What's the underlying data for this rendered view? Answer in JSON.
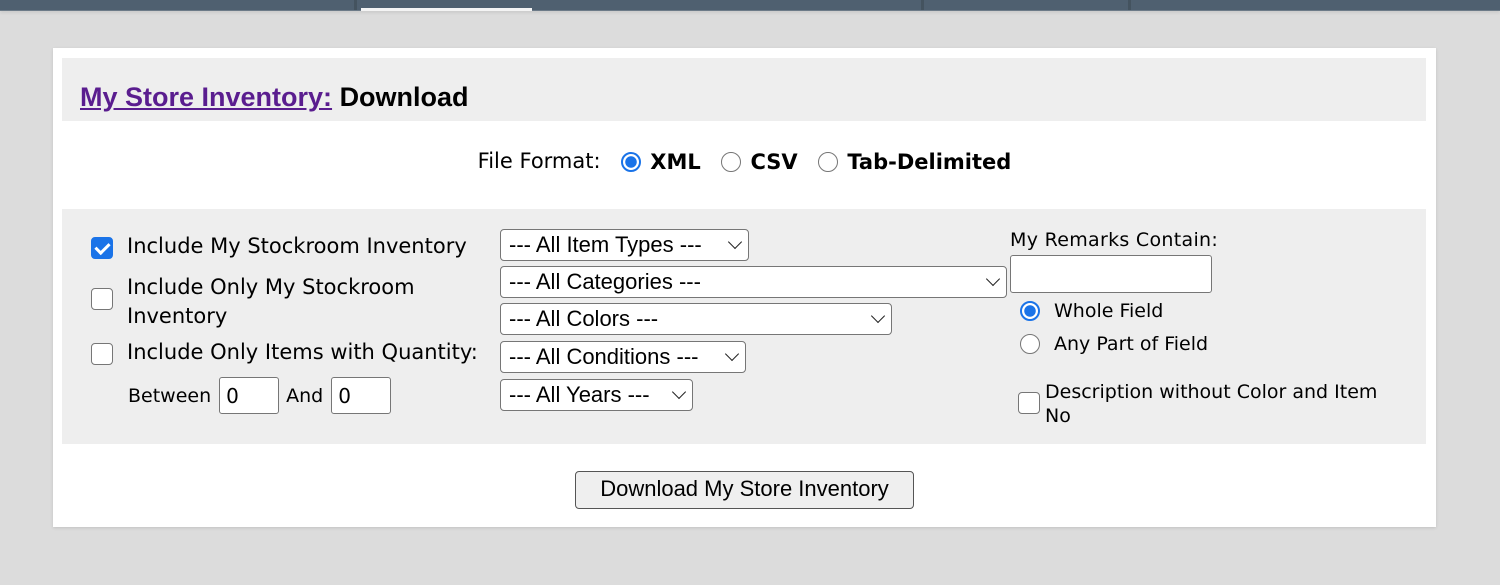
{
  "topnav": {
    "active_tab_index": 1
  },
  "header": {
    "link_text": "My Store Inventory:",
    "title": "Download"
  },
  "file_format": {
    "label": "File Format:",
    "options": [
      {
        "label": "XML",
        "selected": true
      },
      {
        "label": "CSV",
        "selected": false
      },
      {
        "label": "Tab-Delimited",
        "selected": false
      }
    ]
  },
  "filters": {
    "checkboxes": [
      {
        "label": "Include My Stockroom Inventory",
        "checked": true
      },
      {
        "label_line1": "Include Only My Stockroom",
        "label_line2": "Inventory",
        "checked": false
      },
      {
        "label": "Include Only Items with Quantity:",
        "checked": false
      }
    ],
    "quantity": {
      "between_label": "Between",
      "min_value": "0",
      "and_label": "And",
      "max_value": "0"
    },
    "selects": {
      "item_types": "--- All Item Types ---",
      "categories": "--- All Categories ---",
      "colors": "--- All Colors ---",
      "conditions": "--- All Conditions ---",
      "years": "--- All Years ---"
    },
    "remarks": {
      "label": "My Remarks Contain:",
      "value": "",
      "match_options": [
        {
          "label": "Whole Field",
          "selected": true
        },
        {
          "label": "Any Part of Field",
          "selected": false
        }
      ]
    },
    "description_option": {
      "label_line1": "Description without Color and Item",
      "label_line2": "No",
      "checked": false
    }
  },
  "download_button": "Download My Store Inventory"
}
